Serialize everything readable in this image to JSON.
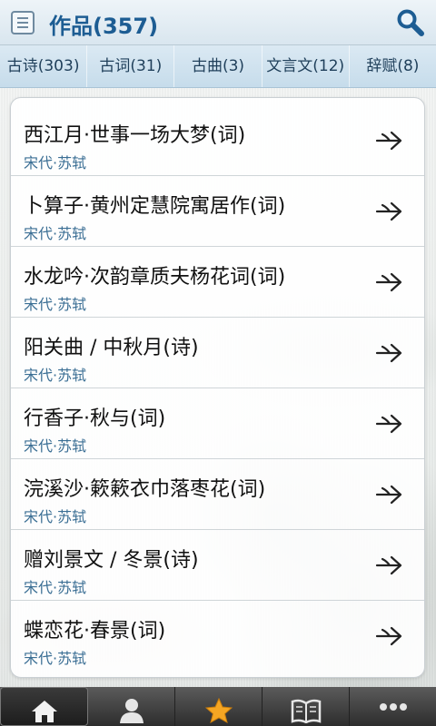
{
  "header": {
    "title": "作品(357)",
    "menu_icon": "menu-icon",
    "search_icon": "search-icon"
  },
  "tabs": [
    {
      "label": "古诗(303)"
    },
    {
      "label": "古词(31)"
    },
    {
      "label": "古曲(3)"
    },
    {
      "label": "文言文(12)"
    },
    {
      "label": "辞赋(8)"
    }
  ],
  "works": [
    {
      "title": "西江月·世事一场大梦(词)",
      "author": "宋代·苏轼"
    },
    {
      "title": "卜算子·黄州定慧院寓居作(词)",
      "author": "宋代·苏轼"
    },
    {
      "title": "水龙吟·次韵章质夫杨花词(词)",
      "author": "宋代·苏轼"
    },
    {
      "title": "阳关曲 / 中秋月(诗)",
      "author": "宋代·苏轼"
    },
    {
      "title": "行香子·秋与(词)",
      "author": "宋代·苏轼"
    },
    {
      "title": "浣溪沙·簌簌衣巾落枣花(词)",
      "author": "宋代·苏轼"
    },
    {
      "title": "赠刘景文 / 冬景(诗)",
      "author": "宋代·苏轼"
    },
    {
      "title": "蝶恋花·春景(词)",
      "author": "宋代·苏轼"
    }
  ],
  "bottom_nav": [
    {
      "icon": "home-icon",
      "active": true
    },
    {
      "icon": "person-icon",
      "active": false
    },
    {
      "icon": "star-icon",
      "active": false
    },
    {
      "icon": "book-icon",
      "active": false
    },
    {
      "icon": "more-icon",
      "active": false
    }
  ],
  "colors": {
    "title": "#1d5d93",
    "author": "#3a6e94",
    "star": "#f5a623"
  }
}
